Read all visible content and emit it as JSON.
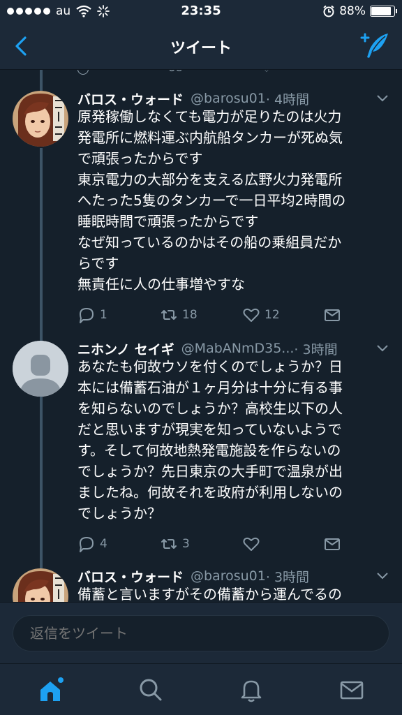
{
  "status_bar": {
    "carrier": "au",
    "time": "23:35",
    "battery_percent": "88%",
    "battery_level": 0.88
  },
  "nav": {
    "title": "ツイート"
  },
  "tweets": [
    {
      "name": "バロス・ウォード",
      "handle": "@barosu01",
      "time": "· 4時間",
      "text": "原発稼働しなくても電力が足りたのは火力\n発電所に燃料運ぶ内航船タンカーが死ぬ気\nで頑張ったからです\n東京電力の大部分を支える広野火力発電所\nへたった5隻のタンカーで一日平均2時間の\n睡眠時間で頑張ったからです\nなぜ知っているのかはその船の乗組員だか\nらです\n無責任に人の仕事増やすな",
      "replies": "1",
      "retweets": "18",
      "likes": "12"
    },
    {
      "name": "ニホンノ セイギ",
      "handle": "@MabANmD35...",
      "time": "· 3時間",
      "text": "あなたも何故ウソを付くのでしょうか？日\n本には備蓄石油が１ヶ月分は十分に有る事\nを知らないのでしょうか？高校生以下の人\nだと思いますが現実を知っていないようで\nす。そして何故地熱発電施設を作らないの\nでしょうか？先日東京の大手町で温泉が出\nましたね。何故それを政府が利用しないの\nでしょうか？",
      "replies": "4",
      "retweets": "3",
      "likes": ""
    },
    {
      "name": "バロス・ウォード",
      "handle": "@barosu01",
      "time": "· 3時間",
      "text": "備蓄と言いますがその備蓄から運んでるの"
    }
  ],
  "reply": {
    "placeholder": "返信をツイート"
  },
  "tabs": [
    "home-icon",
    "search-icon",
    "notifications-icon",
    "messages-icon"
  ],
  "colors": {
    "background": "#15202b",
    "bar": "#1c2938",
    "accent": "#1da1f2",
    "muted": "#8899a6",
    "thread_line": "#3d5466"
  }
}
